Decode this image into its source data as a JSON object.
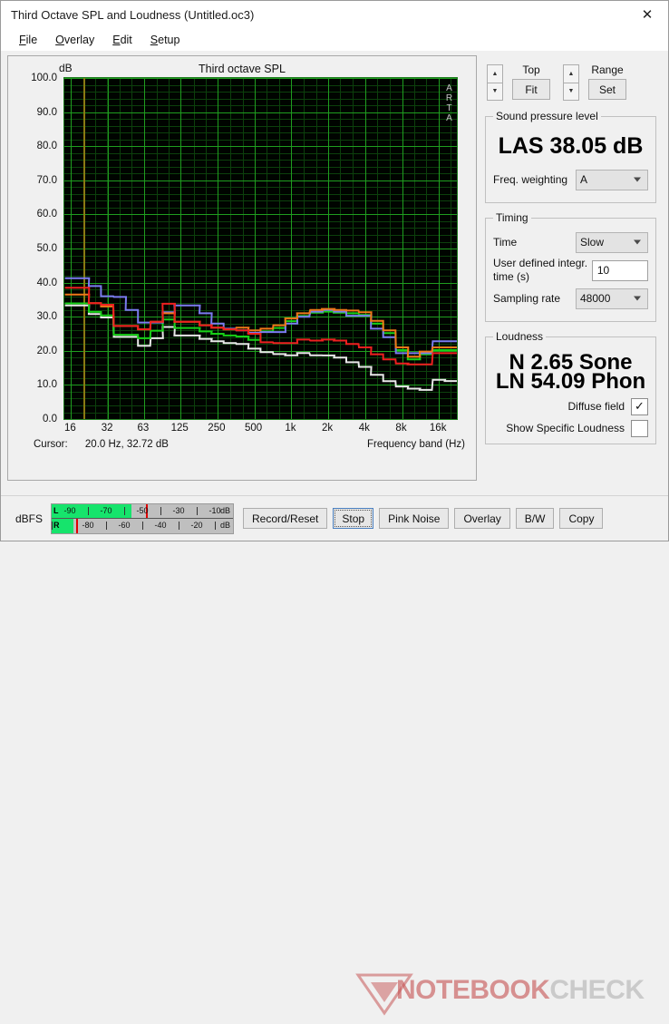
{
  "window": {
    "title": "Third Octave SPL and Loudness (Untitled.oc3)",
    "close_icon": "close-icon"
  },
  "menu": {
    "items": [
      {
        "label": "File",
        "accel": "F"
      },
      {
        "label": "Overlay",
        "accel": "O"
      },
      {
        "label": "Edit",
        "accel": "E"
      },
      {
        "label": "Setup",
        "accel": "S"
      }
    ]
  },
  "graph": {
    "title": "Third octave SPL",
    "y_unit": "dB",
    "watermark": "ARTA",
    "x_axis_label": "Frequency band (Hz)",
    "cursor_label": "Cursor:",
    "cursor_value": "20.0 Hz, 32.72 dB"
  },
  "chart_data": {
    "type": "line",
    "title": "Third octave SPL",
    "xlabel": "Frequency band (Hz)",
    "ylabel": "dB",
    "ylim": [
      0.0,
      100.0
    ],
    "ytick_labels": [
      "100.0",
      "90.0",
      "80.0",
      "70.0",
      "60.0",
      "50.0",
      "40.0",
      "30.0",
      "20.0",
      "10.0",
      "0.0"
    ],
    "ytick_values": [
      100,
      90,
      80,
      70,
      60,
      50,
      40,
      30,
      20,
      10,
      0
    ],
    "xtick_labels": [
      "16",
      "32",
      "63",
      "125",
      "250",
      "500",
      "1k",
      "2k",
      "4k",
      "8k",
      "16k"
    ],
    "xtick_values": [
      16,
      32,
      63,
      125,
      250,
      500,
      1000,
      2000,
      4000,
      8000,
      16000
    ],
    "grid": true,
    "legend": "none",
    "categories": [
      16,
      20,
      25,
      31.5,
      40,
      50,
      63,
      80,
      100,
      125,
      160,
      200,
      250,
      315,
      400,
      500,
      630,
      800,
      1000,
      1250,
      1600,
      2000,
      2500,
      3150,
      4000,
      5000,
      6300,
      8000,
      10000,
      12500,
      16000,
      20000
    ],
    "series": [
      {
        "name": "trace-blue",
        "color": "#7b7bf0",
        "values": [
          41.3,
          41.3,
          39.0,
          36.0,
          35.8,
          32.0,
          28.3,
          28.3,
          31.3,
          33.3,
          33.3,
          31.0,
          28.0,
          26.5,
          26.0,
          25.3,
          25.5,
          25.5,
          28.0,
          30.0,
          31.5,
          32.0,
          31.5,
          30.3,
          30.3,
          26.5,
          24.0,
          19.3,
          19.3,
          19.3,
          22.8,
          22.8
        ]
      },
      {
        "name": "trace-red",
        "color": "#ee2020",
        "values": [
          38.5,
          38.5,
          34.0,
          33.5,
          27.3,
          27.3,
          26.3,
          28.5,
          33.8,
          28.5,
          28.5,
          27.5,
          26.8,
          26.3,
          26.0,
          25.0,
          22.5,
          22.3,
          22.3,
          23.3,
          23.0,
          23.3,
          23.0,
          22.0,
          21.0,
          19.0,
          17.5,
          16.3,
          16.0,
          16.0,
          19.3,
          19.3
        ]
      },
      {
        "name": "trace-orange",
        "color": "#f07818",
        "values": [
          36.5,
          36.5,
          34.0,
          33.0,
          27.3,
          27.3,
          26.3,
          28.5,
          31.0,
          28.5,
          28.5,
          27.5,
          26.8,
          26.3,
          26.8,
          26.0,
          26.5,
          27.5,
          29.5,
          31.0,
          32.0,
          32.3,
          32.0,
          31.8,
          31.3,
          28.8,
          26.0,
          21.0,
          18.3,
          19.8,
          21.0,
          21.0
        ]
      },
      {
        "name": "trace-green",
        "color": "#17d017"
      },
      {
        "name": "trace-white",
        "color": "#e8e8e8"
      }
    ],
    "cursor": {
      "frequency_hz": 20.0,
      "level_db": 32.72
    }
  },
  "top_controls": {
    "top_label": "Top",
    "top_button": "Fit",
    "range_label": "Range",
    "range_button": "Set",
    "up_icon": "chevron-up-icon",
    "down_icon": "chevron-down-icon"
  },
  "spl": {
    "group_label": "Sound pressure level",
    "value": "LAS 38.05 dB",
    "weighting_label": "Freq. weighting",
    "weighting_value": "A"
  },
  "timing": {
    "group_label": "Timing",
    "time_label": "Time",
    "time_value": "Slow",
    "integr_label": "User defined integr. time (s)",
    "integr_value": "10",
    "sampling_label": "Sampling rate",
    "sampling_value": "48000"
  },
  "loudness": {
    "group_label": "Loudness",
    "sone": "N 2.65 Sone",
    "phon": "LN 54.09 Phon",
    "diffuse_label": "Diffuse field",
    "diffuse_checked": "✓",
    "specific_label": "Show Specific Loudness",
    "specific_checked": ""
  },
  "meter": {
    "unit_label": "dBFS",
    "left_channel": "L",
    "right_channel": "R",
    "db_suffix": "dB",
    "top_ticks": [
      "-90",
      "-70",
      "-50",
      "-30",
      "-10"
    ],
    "bottom_ticks": [
      "-80",
      "-60",
      "-40",
      "-20"
    ],
    "left_fill_pct": 44,
    "right_fill_pct": 12,
    "peak_pct": 52
  },
  "buttons": [
    {
      "label": "Record/Reset",
      "focused": false
    },
    {
      "label": "Stop",
      "focused": true
    },
    {
      "label": "Pink Noise",
      "focused": false
    },
    {
      "label": "Overlay",
      "focused": false
    },
    {
      "label": "B/W",
      "focused": false
    },
    {
      "label": "Copy",
      "focused": false
    }
  ],
  "watermark": {
    "text_a": "NOTEBOOK",
    "text_b": "CHECK"
  }
}
